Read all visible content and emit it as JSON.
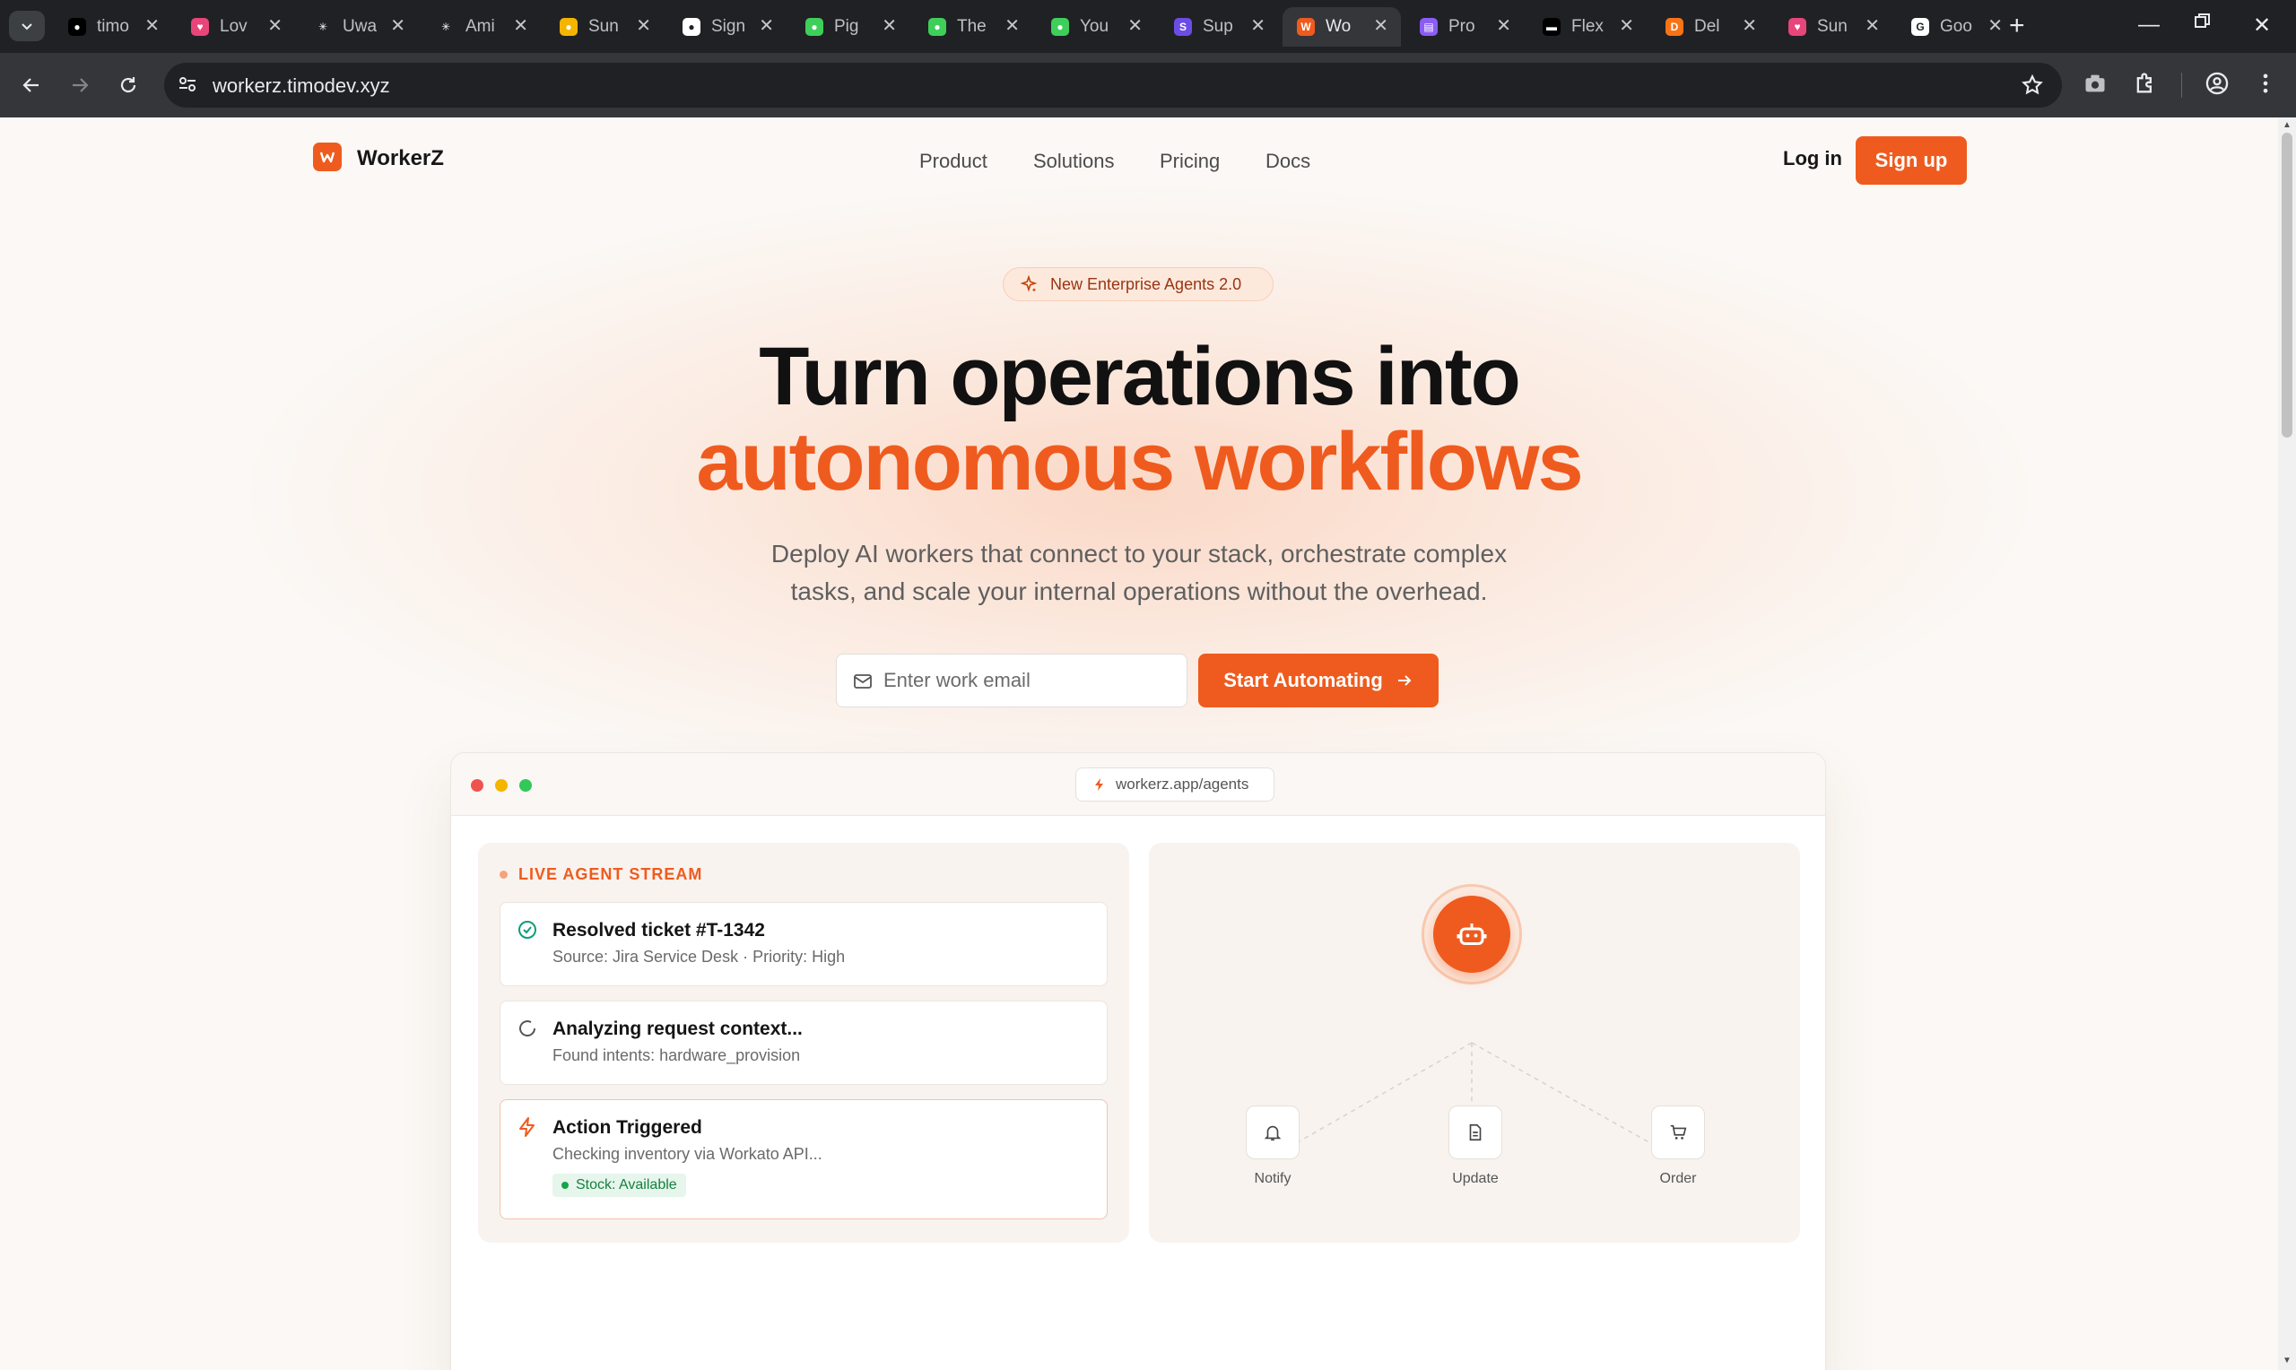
{
  "browser": {
    "tabs": [
      {
        "title": "timo",
        "fav_color": "#000000",
        "fav_glyph": "●"
      },
      {
        "title": "Lov",
        "fav_color": "#e8457a",
        "fav_glyph": "♥"
      },
      {
        "title": "Uwa",
        "fav_color": "#202124",
        "fav_glyph": "✳"
      },
      {
        "title": "Ami",
        "fav_color": "#202124",
        "fav_glyph": "✳"
      },
      {
        "title": "Sun",
        "fav_color": "#f4b400",
        "fav_glyph": "●"
      },
      {
        "title": "Sign",
        "fav_color": "#ffffff",
        "fav_glyph": "●"
      },
      {
        "title": "Pig",
        "fav_color": "#3ecf5a",
        "fav_glyph": "●"
      },
      {
        "title": "The",
        "fav_color": "#3ecf5a",
        "fav_glyph": "●"
      },
      {
        "title": "You",
        "fav_color": "#3ecf5a",
        "fav_glyph": "●"
      },
      {
        "title": "Sup",
        "fav_color": "#6b4de6",
        "fav_glyph": "S"
      },
      {
        "title": "Wo",
        "fav_color": "#ef5b1e",
        "fav_glyph": "W"
      },
      {
        "title": "Pro",
        "fav_color": "#8b5cf6",
        "fav_glyph": "▤"
      },
      {
        "title": "Flex",
        "fav_color": "#000000",
        "fav_glyph": "▬"
      },
      {
        "title": "Del",
        "fav_color": "#f97316",
        "fav_glyph": "D"
      },
      {
        "title": "Sun",
        "fav_color": "#e8457a",
        "fav_glyph": "♥"
      },
      {
        "title": "Goo",
        "fav_color": "#ffffff",
        "fav_glyph": "G"
      }
    ],
    "active_tab_index": 10,
    "url": "workerz.timodev.xyz"
  },
  "site": {
    "brand": "WorkerZ",
    "logo_glyph": "W",
    "nav": [
      "Product",
      "Solutions",
      "Pricing",
      "Docs"
    ],
    "login": "Log in",
    "signup": "Sign up",
    "badge": "New Enterprise Agents 2.0",
    "headline_line1": "Turn operations into",
    "headline_line2": "autonomous workflows",
    "subtitle_line1": "Deploy AI workers that connect to your stack, orchestrate complex",
    "subtitle_line2": "tasks, and scale your internal operations without the overhead.",
    "email_placeholder": "Enter work email",
    "cta": "Start Automating",
    "accent_color": "#ef5b1e"
  },
  "app_preview": {
    "url": "workerz.app/agents",
    "stream_title": "LIVE AGENT STREAM",
    "events": [
      {
        "title": "Resolved ticket #T-1342",
        "subtitle": "Source: Jira Service Desk · Priority: High",
        "icon": "check-circle-icon"
      },
      {
        "title": "Analyzing request context...",
        "subtitle": "Found intents: hardware_provision",
        "icon": "spinner-icon"
      },
      {
        "title": "Action Triggered",
        "subtitle": "Checking inventory via Workato API...",
        "icon": "lightning-icon",
        "status": "Stock: Available"
      }
    ],
    "nodes": [
      {
        "label": "Notify",
        "icon": "bell-icon"
      },
      {
        "label": "Update",
        "icon": "document-icon"
      },
      {
        "label": "Order",
        "icon": "cart-icon"
      }
    ]
  }
}
